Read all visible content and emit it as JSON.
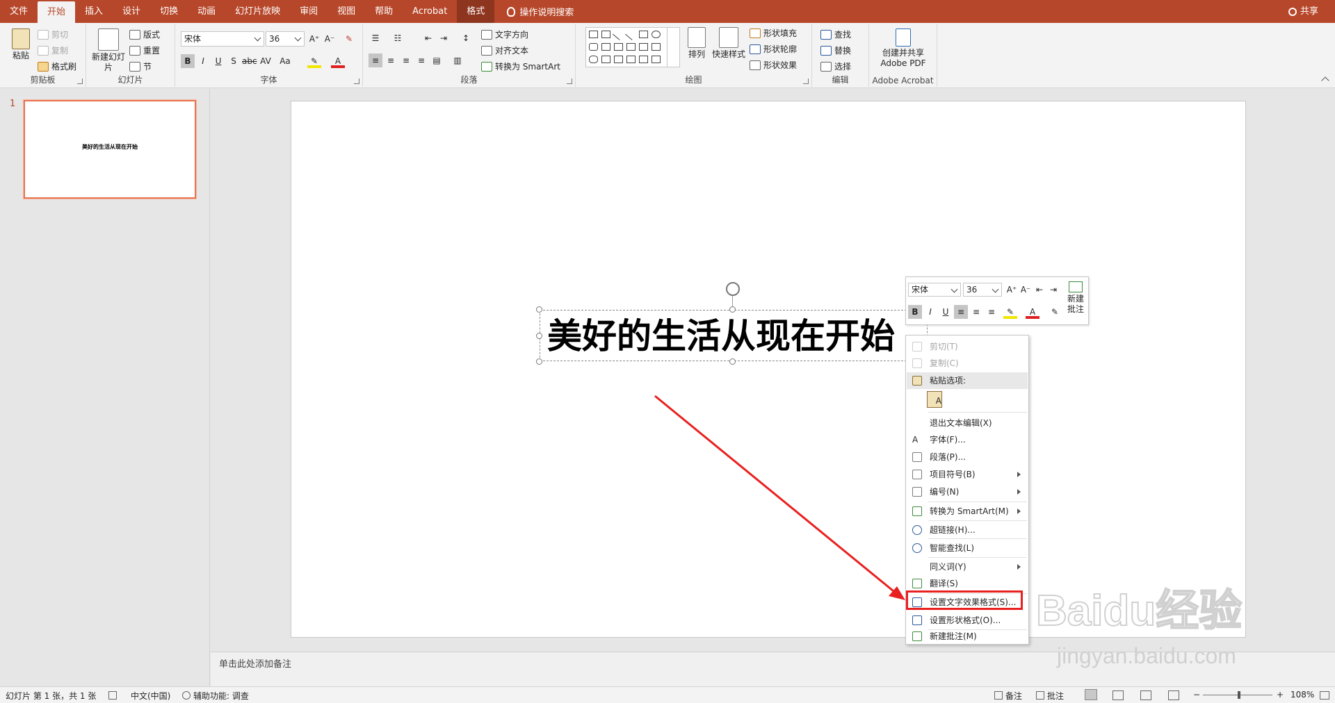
{
  "tabs": [
    "文件",
    "开始",
    "插入",
    "设计",
    "切换",
    "动画",
    "幻灯片放映",
    "审阅",
    "视图",
    "帮助",
    "Acrobat",
    "格式"
  ],
  "active_tab": "开始",
  "tell_me": "操作说明搜索",
  "share": "共享",
  "ribbon": {
    "clipboard": {
      "label": "剪贴板",
      "paste": "粘贴",
      "cut": "剪切",
      "copy": "复制",
      "format_painter": "格式刷"
    },
    "slides": {
      "label": "幻灯片",
      "new_slide": "新建幻灯片",
      "layout": "版式",
      "reset": "重置",
      "section": "节"
    },
    "font": {
      "label": "字体",
      "font_name": "宋体",
      "font_size": "36"
    },
    "paragraph": {
      "label": "段落",
      "text_direction": "文字方向",
      "align_text": "对齐文本",
      "convert_smartart": "转换为 SmartArt"
    },
    "drawing": {
      "label": "绘图",
      "arrange": "排列",
      "quick_styles": "快速样式",
      "shape_fill": "形状填充",
      "shape_outline": "形状轮廓",
      "shape_effects": "形状效果"
    },
    "editing": {
      "label": "编辑",
      "find": "查找",
      "replace": "替换",
      "select": "选择"
    },
    "acrobat": {
      "label": "Adobe Acrobat",
      "create": "创建并共享 Adobe PDF"
    }
  },
  "thumbnail": {
    "number": "1",
    "title": "美好的生活从现在开始"
  },
  "slide": {
    "title": "美好的生活从现在开始"
  },
  "notes_placeholder": "单击此处添加备注",
  "mini_toolbar": {
    "font_name": "宋体",
    "font_size": "36",
    "new_comment": "新建批注"
  },
  "context_menu": {
    "cut": "剪切(T)",
    "copy": "复制(C)",
    "paste_options": "粘贴选项:",
    "exit_edit": "退出文本编辑(X)",
    "font": "字体(F)...",
    "paragraph": "段落(P)...",
    "bullets": "项目符号(B)",
    "numbering": "编号(N)",
    "smartart": "转换为 SmartArt(M)",
    "hyperlink": "超链接(H)...",
    "smart_lookup": "智能查找(L)",
    "synonyms": "同义词(Y)",
    "translate": "翻译(S)",
    "format_text_effects": "设置文字效果格式(S)...",
    "format_shape": "设置形状格式(O)...",
    "new_comment": "新建批注(M)"
  },
  "status": {
    "slide_info": "幻灯片 第 1 张，共 1 张",
    "language": "中文(中国)",
    "accessibility": "辅助功能: 调查",
    "notes": "备注",
    "comments": "批注",
    "zoom": "108%"
  },
  "watermark": {
    "brand": "Baidu经验",
    "url": "jingyan.baidu.com"
  },
  "colors": {
    "accent": "#b7472a",
    "highlight_box": "#e8201f",
    "arrow": "#e8201f"
  }
}
